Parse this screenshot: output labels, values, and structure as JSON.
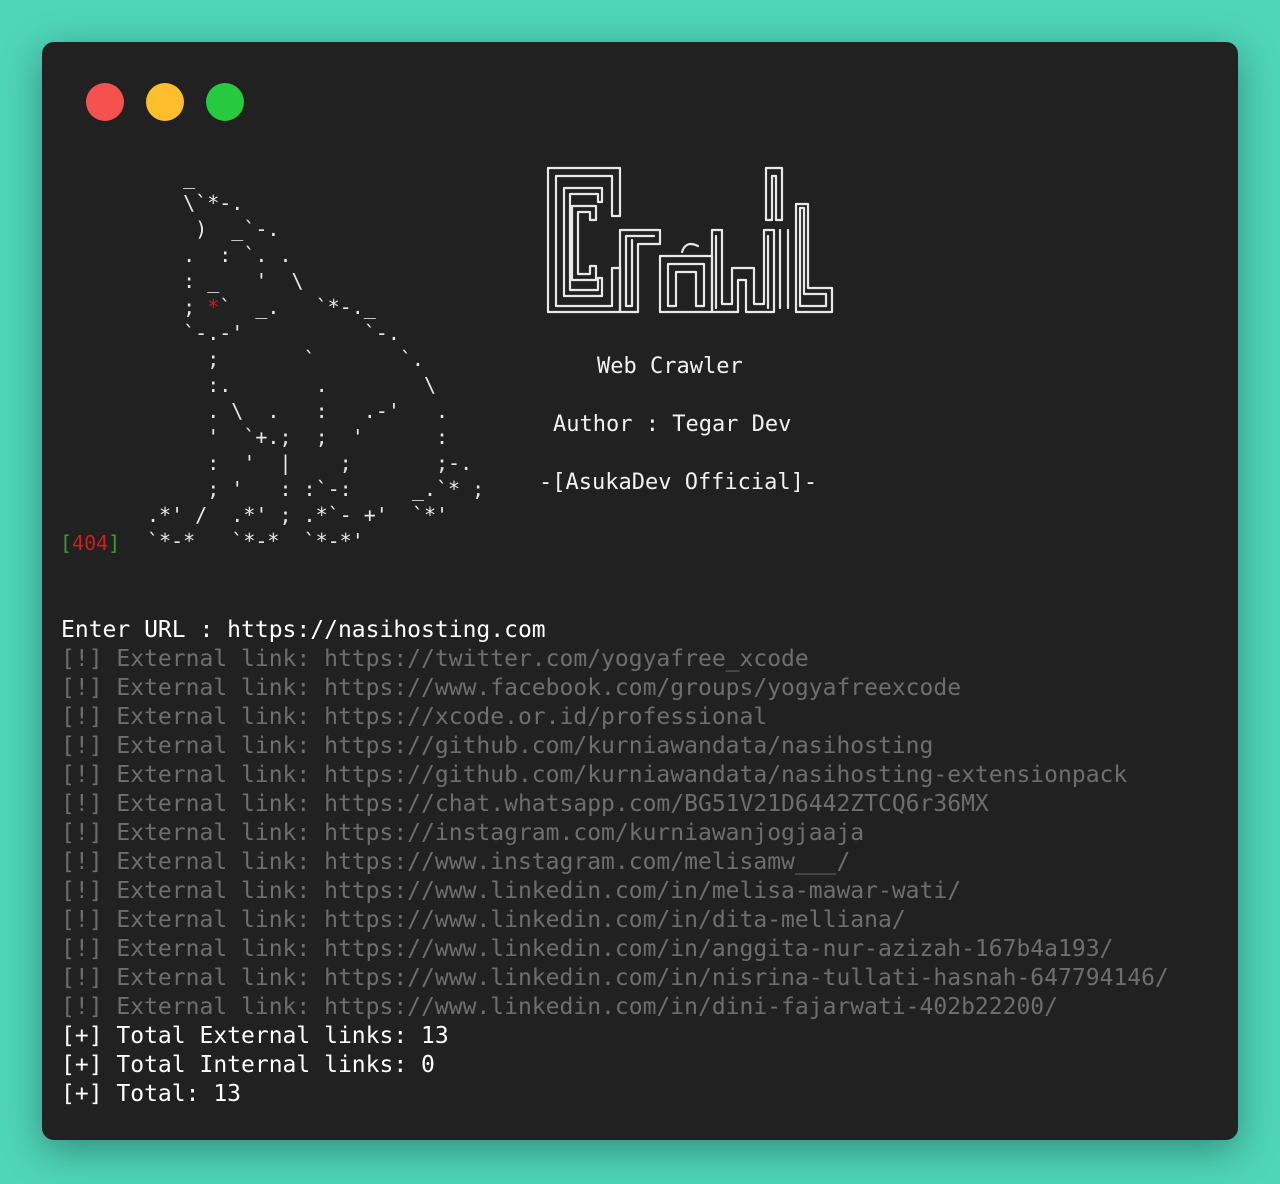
{
  "colors": {
    "background": "#4fd6b9",
    "window": "#212121",
    "close_dot": "#f5524f",
    "minimize_dot": "#fdbd2c",
    "zoom_dot": "#27c93f",
    "text_primary": "#ffffff",
    "text_dim": "#6e6e6e",
    "error_bracket": "#3f9d2c",
    "error_code": "#d41b1b"
  },
  "window_controls": {
    "close": "close-dot",
    "minimize": "minimize-dot",
    "zoom": "zoom-dot"
  },
  "ascii_art": {
    "line_01": "   _",
    "line_02": "   \\`*-.",
    "line_03": "    )  _`-.",
    "line_04": "   .  : `. .",
    "line_05": "   : _   '  \\",
    "line_06_pre": "   ; ",
    "line_06_eye": "*",
    "line_06_post": "`  _.   `*-._",
    "line_07": "   `-.-'          `-.",
    "line_08": "     ;       `       `.",
    "line_09": "     :.       .        \\",
    "line_10": "     . \\  .   :   .-'   .",
    "line_11": "     '  `+.;  ;  '      :",
    "line_12": "     :  '  |    ;       ;-.",
    "line_13": "     ; '   : :`-:     _.`* ;",
    "error_bracket_open": "[",
    "error_code": "404",
    "error_bracket_close": "]",
    "line_14": ".*' /  .*' ; .*`- +'  `*'",
    "line_15": "`*-*   `*-*  `*-*'"
  },
  "logo": {
    "name": "crawl-logo"
  },
  "banner": {
    "title": "Web Crawler",
    "author": "Author : Tegar Dev",
    "credit": "-[AsukaDev Official]-"
  },
  "console": {
    "prompt": "Enter URL : https://nasihosting.com",
    "external_links": [
      "[!] External link: https://twitter.com/yogyafree_xcode",
      "[!] External link: https://www.facebook.com/groups/yogyafreexcode",
      "[!] External link: https://xcode.or.id/professional",
      "[!] External link: https://github.com/kurniawandata/nasihosting",
      "[!] External link: https://github.com/kurniawandata/nasihosting-extensionpack",
      "[!] External link: https://chat.whatsapp.com/BG51V21D6442ZTCQ6r36MX",
      "[!] External link: https://instagram.com/kurniawanjogjaaja",
      "[!] External link: https://www.instagram.com/melisamw___/",
      "[!] External link: https://www.linkedin.com/in/melisa-mawar-wati/",
      "[!] External link: https://www.linkedin.com/in/dita-melliana/",
      "[!] External link: https://www.linkedin.com/in/anggita-nur-azizah-167b4a193/",
      "[!] External link: https://www.linkedin.com/in/nisrina-tullati-hasnah-647794146/",
      "[!] External link: https://www.linkedin.com/in/dini-fajarwati-402b22200/"
    ],
    "total_external": "[+] Total External links: 13",
    "total_internal": "[+] Total Internal links: 0",
    "total": "[+] Total: 13"
  }
}
